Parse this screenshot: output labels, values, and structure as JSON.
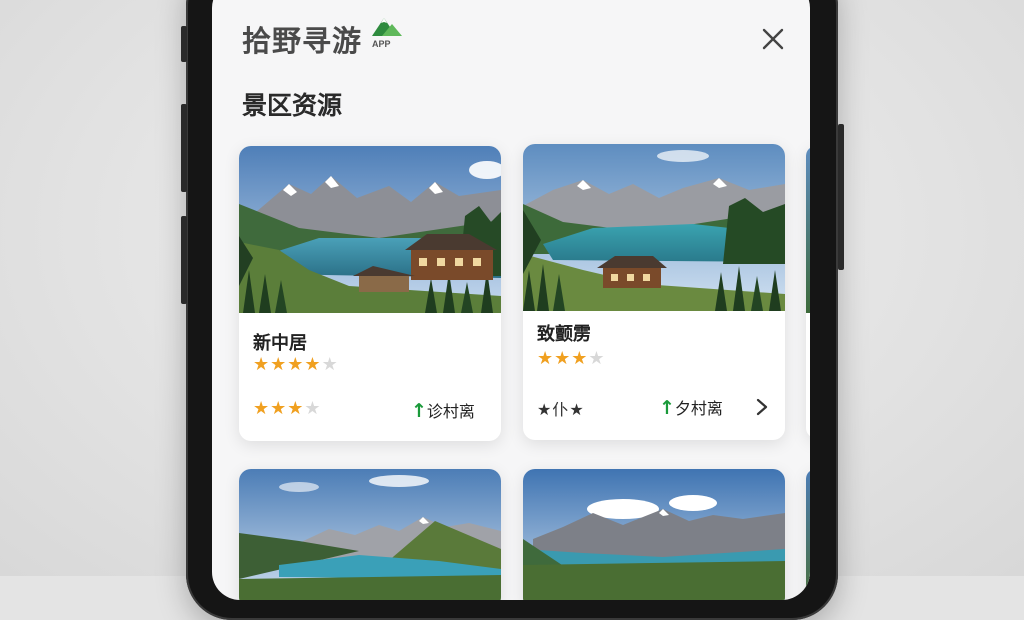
{
  "app": {
    "title": "拾野寻游",
    "logo_badge": "APP",
    "logo_icon": "mountain-logo-icon",
    "close_icon": "close-icon"
  },
  "section": {
    "title": "景区资源"
  },
  "cards": [
    {
      "name": "新中居",
      "rating_stars": 4,
      "secondary_stars": 3,
      "distance_label": "诊村离"
    },
    {
      "name": "致颤雳",
      "rating_stars": 3,
      "secondary_label": "★仆★",
      "distance_label": "夕村离"
    }
  ],
  "colors": {
    "star": "#f0a020",
    "arrow": "#1a9a3a",
    "screen_bg": "#f6f6f7"
  }
}
